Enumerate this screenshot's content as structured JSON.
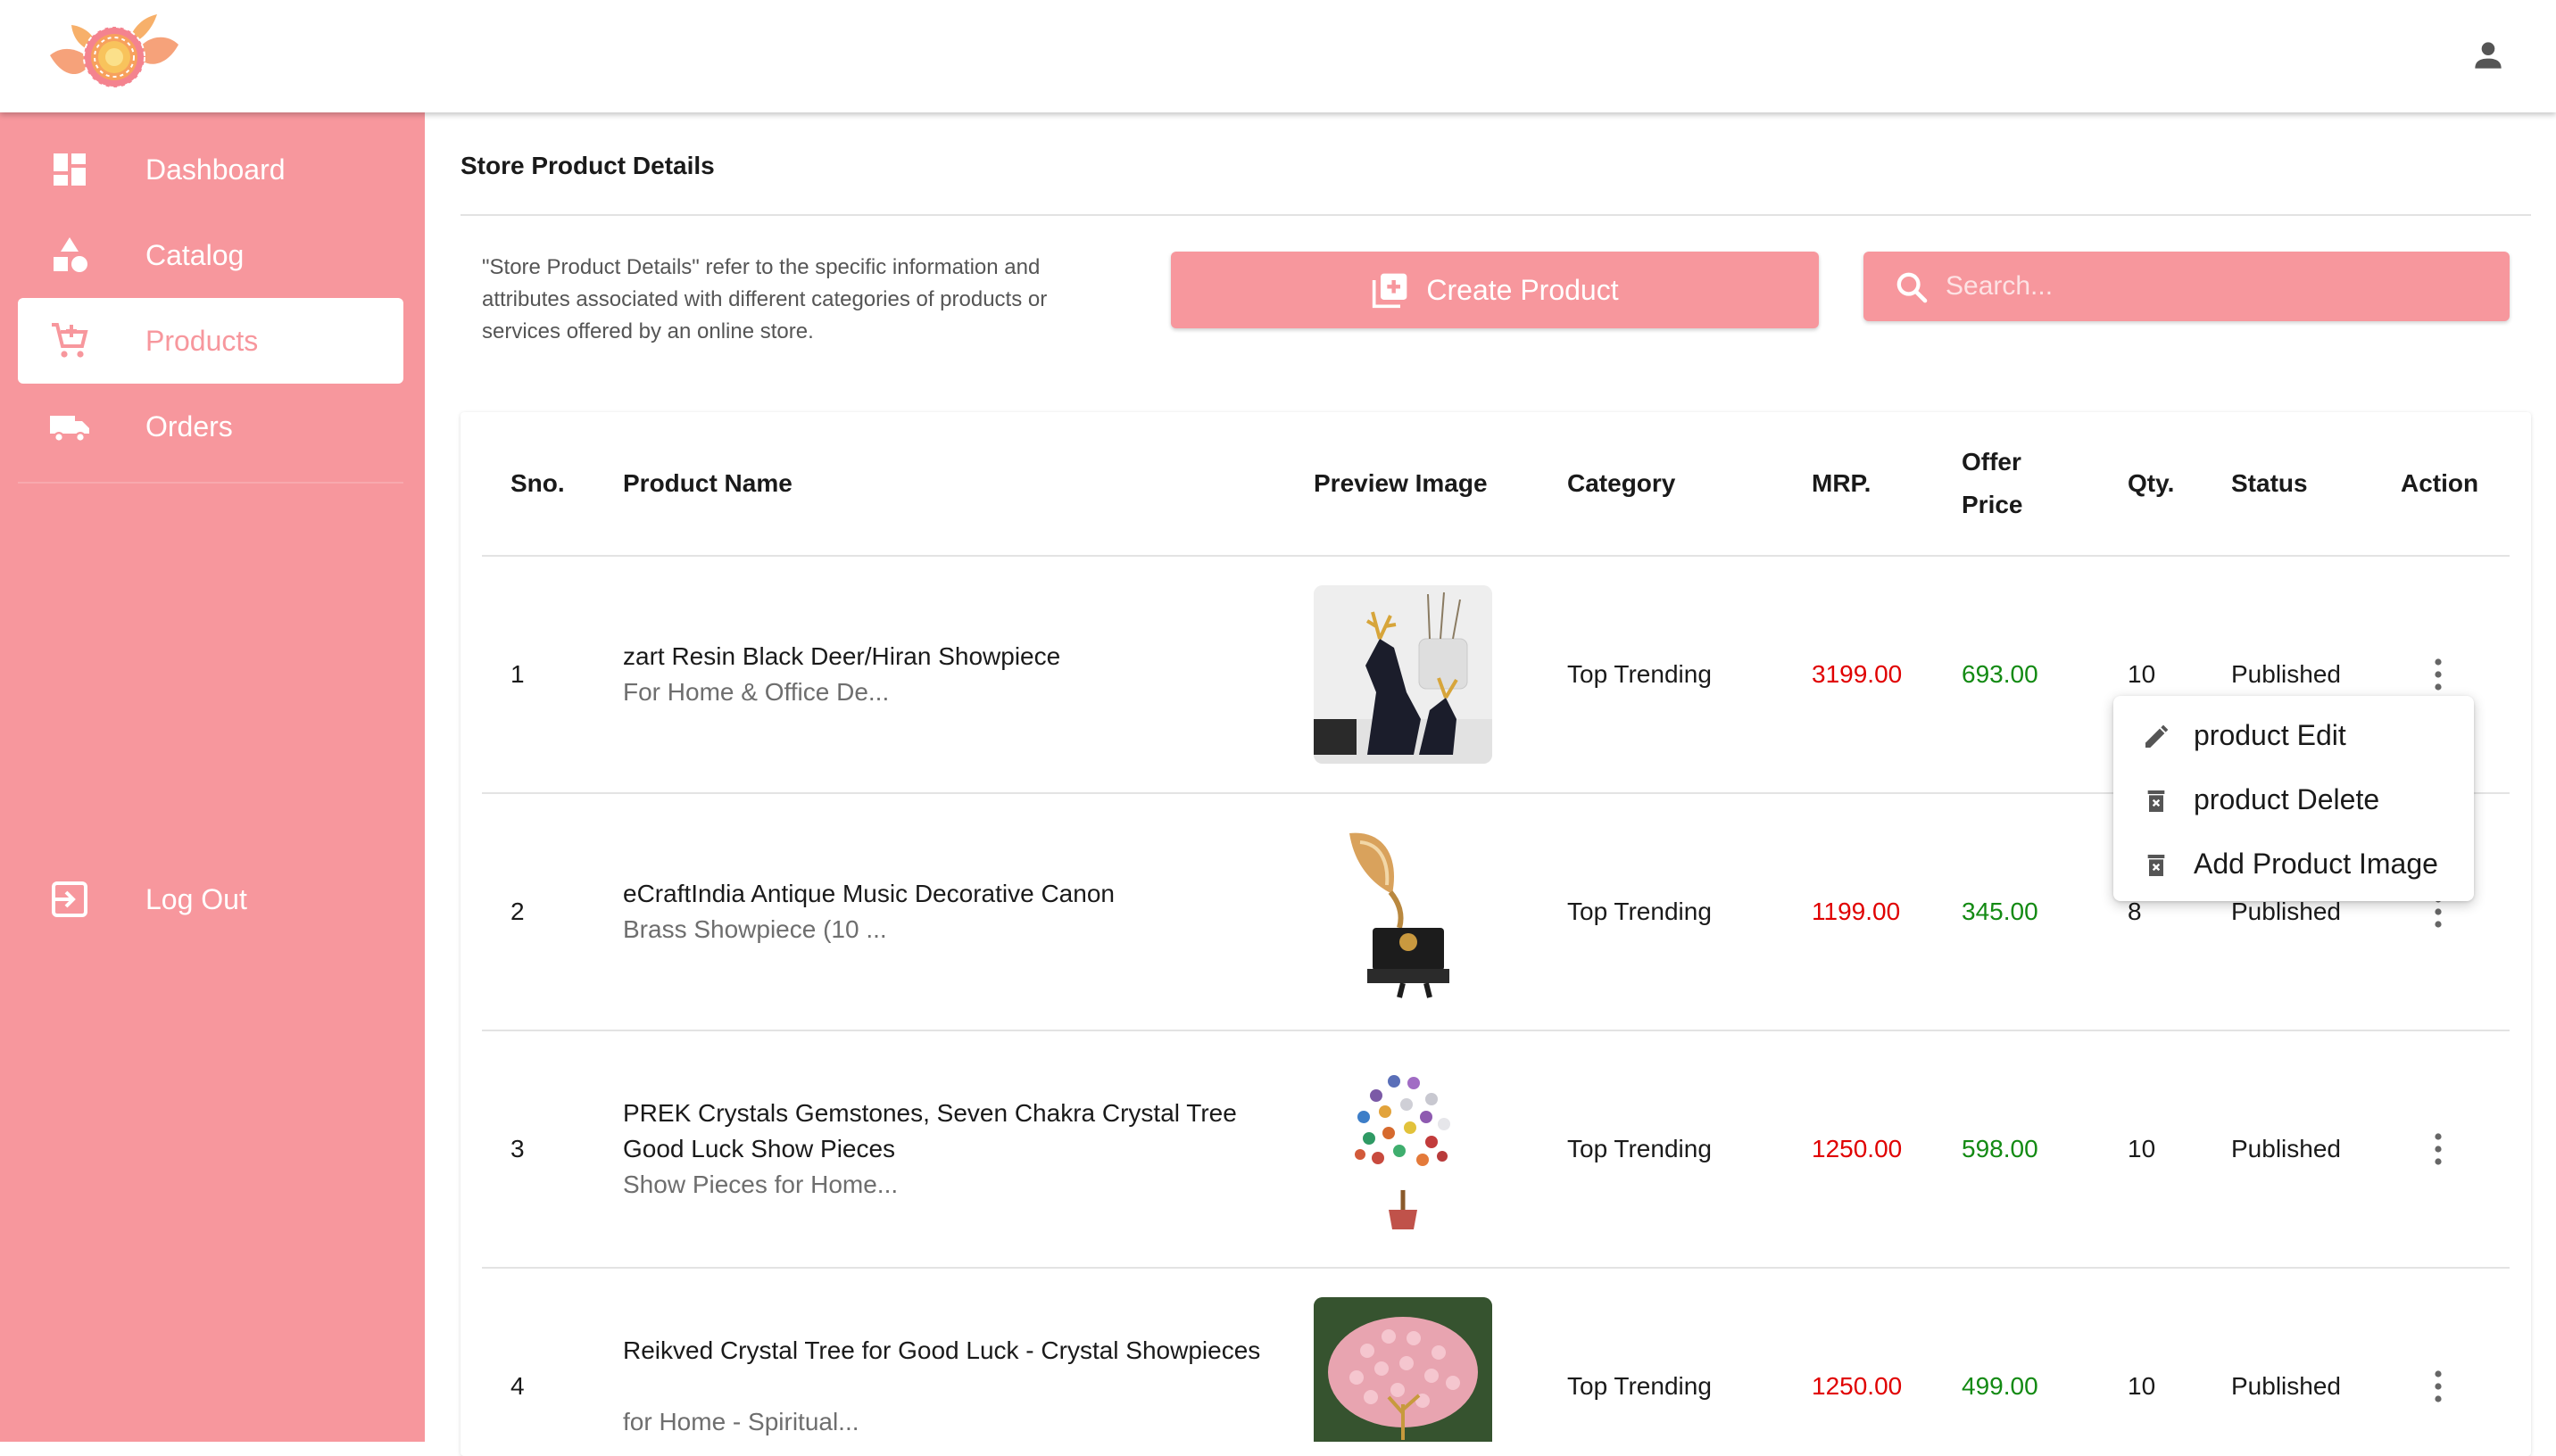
{
  "brand": {
    "accent": "#f7979d",
    "logo": "lotus-logo"
  },
  "header": {
    "user_icon": "account-icon"
  },
  "sidebar": {
    "items": [
      {
        "label": "Dashboard",
        "icon": "dashboard-icon",
        "active": false
      },
      {
        "label": "Catalog",
        "icon": "shapes-icon",
        "active": false
      },
      {
        "label": "Products",
        "icon": "cart-icon",
        "active": true
      },
      {
        "label": "Orders",
        "icon": "truck-icon",
        "active": false
      }
    ],
    "logout": {
      "label": "Log Out",
      "icon": "logout-icon"
    }
  },
  "main": {
    "title": "Store Product Details",
    "description": "\"Store Product Details\" refer to the specific information and attributes associated with different categories of products or services offered by an online store.",
    "create_button": "Create Product",
    "search": {
      "placeholder": "Search...",
      "value": ""
    }
  },
  "table": {
    "headers": {
      "sno": "Sno.",
      "name": "Product Name",
      "preview": "Preview Image",
      "category": "Category",
      "mrp": "MRP.",
      "offer_line1": "Offer",
      "offer_line2": "Price",
      "qty": "Qty.",
      "status": "Status",
      "action": "Action"
    },
    "rows": [
      {
        "sno": "1",
        "title": "zart Resin Black Deer/Hiran Showpiece",
        "subtitle": "For Home & Office De...",
        "image": "deer-showpiece-image",
        "category": "Top Trending",
        "mrp": "3199.00",
        "offer": "693.00",
        "qty": "10",
        "status": "Published"
      },
      {
        "sno": "2",
        "title": "eCraftIndia Antique Music Decorative Canon",
        "subtitle": "Brass Showpiece (10 ...",
        "image": "gramophone-showpiece-image",
        "category": "Top Trending",
        "mrp": "1199.00",
        "offer": "345.00",
        "qty": "8",
        "status": "Published"
      },
      {
        "sno": "3",
        "title": "PREK Crystals Gemstones, Seven Chakra Crystal Tree Good Luck Show Pieces",
        "subtitle": "Show Pieces for Home...",
        "image": "chakra-crystal-tree-image",
        "category": "Top Trending",
        "mrp": "1250.00",
        "offer": "598.00",
        "qty": "10",
        "status": "Published"
      },
      {
        "sno": "4",
        "title": "Reikved Crystal Tree for Good Luck - Crystal Showpieces",
        "subtitle": "for Home - Spiritual...",
        "image": "pink-crystal-tree-image",
        "category": "Top Trending",
        "mrp": "1250.00",
        "offer": "499.00",
        "qty": "10",
        "status": "Published"
      }
    ]
  },
  "action_menu": {
    "items": [
      {
        "label": "product Edit",
        "icon": "pencil-icon"
      },
      {
        "label": "product Delete",
        "icon": "delete-icon"
      },
      {
        "label": "Add Product Image",
        "icon": "delete-icon"
      }
    ]
  }
}
